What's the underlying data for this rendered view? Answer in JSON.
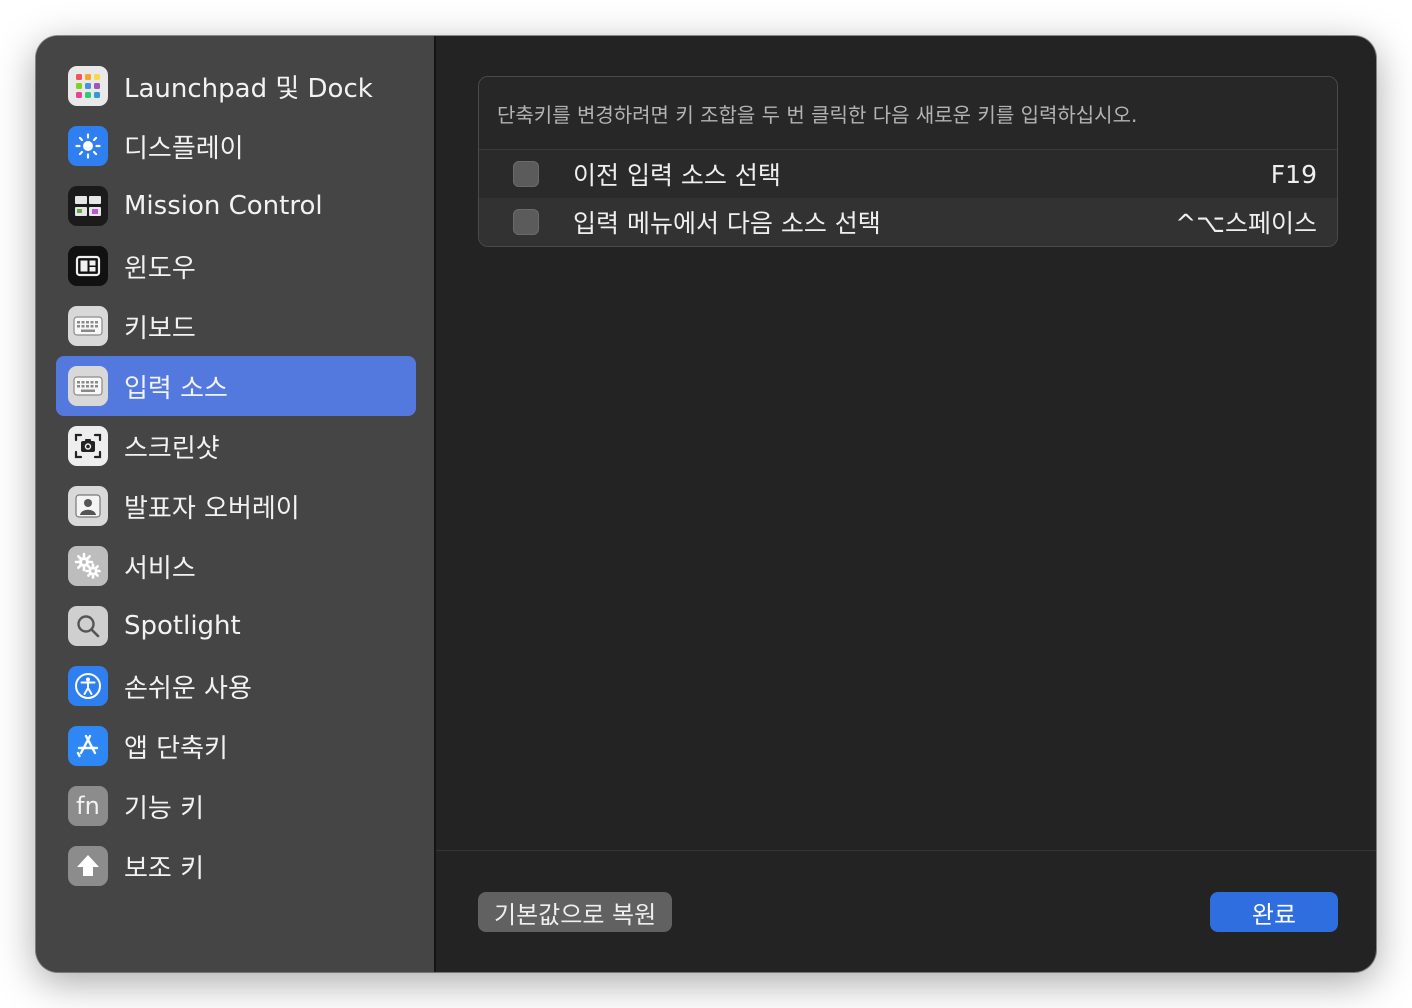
{
  "sidebar": {
    "items": [
      {
        "label": "Launchpad 및 Dock",
        "icon": "launchpad-icon",
        "selected": false
      },
      {
        "label": "디스플레이",
        "icon": "display-brightness-icon",
        "selected": false
      },
      {
        "label": "Mission Control",
        "icon": "mission-control-icon",
        "selected": false
      },
      {
        "label": "윈도우",
        "icon": "window-icon",
        "selected": false
      },
      {
        "label": "키보드",
        "icon": "keyboard-icon",
        "selected": false
      },
      {
        "label": "입력 소스",
        "icon": "keyboard-icon",
        "selected": true
      },
      {
        "label": "스크린샷",
        "icon": "screenshot-camera-icon",
        "selected": false
      },
      {
        "label": "발표자 오버레이",
        "icon": "presenter-overlay-icon",
        "selected": false
      },
      {
        "label": "서비스",
        "icon": "gears-icon",
        "selected": false
      },
      {
        "label": "Spotlight",
        "icon": "magnifier-icon",
        "selected": false
      },
      {
        "label": "손쉬운 사용",
        "icon": "accessibility-icon",
        "selected": false
      },
      {
        "label": "앱 단축키",
        "icon": "app-store-icon",
        "selected": false
      },
      {
        "label": "기능 키",
        "icon": "fn-key-icon",
        "selected": false
      },
      {
        "label": "보조 키",
        "icon": "modifier-arrow-up-icon",
        "selected": false
      }
    ]
  },
  "shortcuts": {
    "hint": "단축키를 변경하려면 키 조합을 두 번 클릭한 다음 새로운 키를 입력하십시오.",
    "rows": [
      {
        "label": "이전 입력 소스 선택",
        "key": "F19",
        "checked": false
      },
      {
        "label": "입력 메뉴에서 다음 소스 선택",
        "key": "^⌥스페이스",
        "checked": false
      }
    ]
  },
  "footer": {
    "restore_label": "기본값으로 복원",
    "done_label": "완료"
  },
  "colors": {
    "accent": "#5479de",
    "done_button": "#2f6ede",
    "sidebar_bg": "#454545",
    "main_bg": "#232323"
  }
}
